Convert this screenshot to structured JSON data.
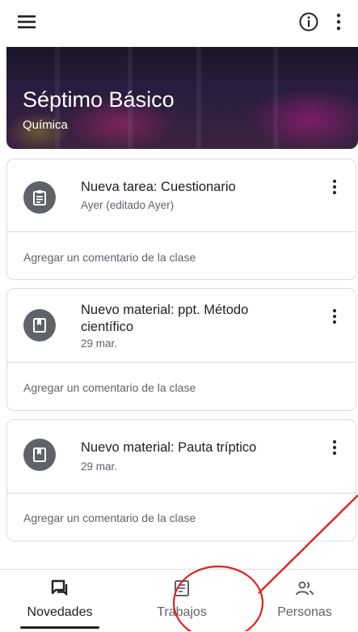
{
  "header": {
    "menu_icon": "menu-icon",
    "info_icon": "info-icon",
    "more_icon": "more-vert-icon"
  },
  "banner": {
    "title": "Séptimo Básico",
    "subtitle": "Química"
  },
  "posts": [
    {
      "icon": "assignment-icon",
      "title": "Nueva tarea: Cuestionario",
      "date": "Ayer (editado Ayer)",
      "comment_placeholder": "Agregar un comentario de la clase"
    },
    {
      "icon": "book-icon",
      "title": "Nuevo material: ppt. Método científico",
      "date": "29 mar.",
      "comment_placeholder": "Agregar un comentario de la clase"
    },
    {
      "icon": "book-icon",
      "title": "Nuevo material: Pauta tríptico",
      "date": "29 mar.",
      "comment_placeholder": "Agregar un comentario de la clase"
    }
  ],
  "bottom_nav": {
    "items": [
      {
        "label": "Novedades",
        "icon": "stream-icon",
        "active": true
      },
      {
        "label": "Trabajos",
        "icon": "classwork-icon",
        "active": false
      },
      {
        "label": "Personas",
        "icon": "people-icon",
        "active": false
      }
    ]
  },
  "colors": {
    "annotation": "#e02020",
    "icon_circle": "#5f6368",
    "text_primary": "#202124",
    "text_secondary": "#5f6368"
  }
}
